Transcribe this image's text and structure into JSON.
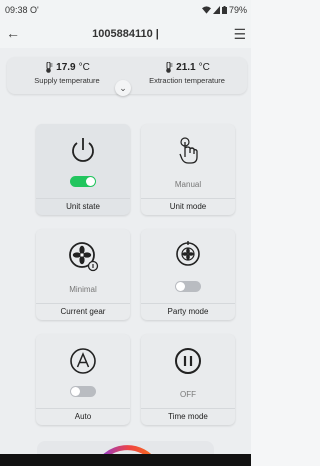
{
  "status_bar": {
    "time": "09:38",
    "extra": "O'",
    "battery": "79%"
  },
  "header": {
    "title": "1005884110 |"
  },
  "temperatures": {
    "supply": {
      "value": "17.9",
      "unit": "°C",
      "label": "Supply temperature"
    },
    "extraction": {
      "value": "21.1",
      "unit": "°C",
      "label": "Extraction temperature"
    }
  },
  "tiles": {
    "unit_state": {
      "label": "Unit state",
      "toggle": "on"
    },
    "unit_mode": {
      "label": "Unit mode",
      "value": "Manual"
    },
    "current_gear": {
      "label": "Current gear",
      "value": "Minimal"
    },
    "party_mode": {
      "label": "Party mode",
      "toggle": "off"
    },
    "auto": {
      "label": "Auto",
      "toggle": "off"
    },
    "time_mode": {
      "label": "Time mode",
      "value": "OFF"
    }
  },
  "colors": {
    "toggle_on": "#22c55e",
    "toggle_off": "#b9bcc1",
    "gauge_start": "#7c3aed",
    "gauge_end": "#f97316"
  }
}
